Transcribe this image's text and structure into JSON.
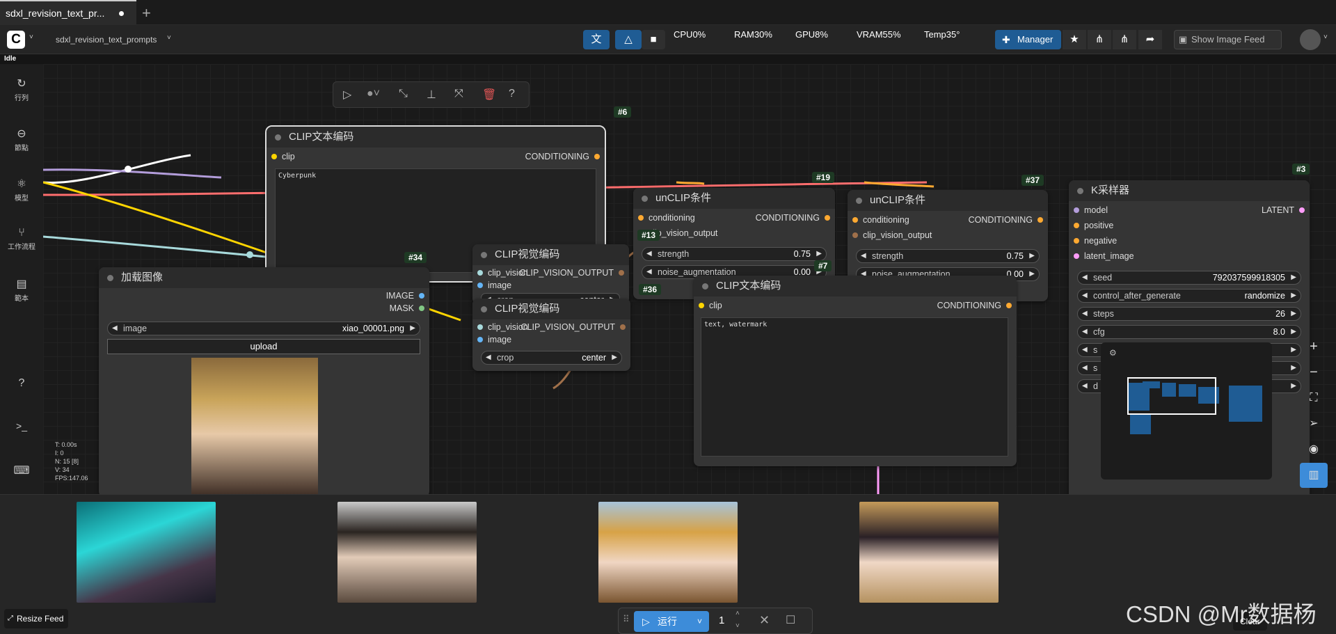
{
  "tab": {
    "title": "sdxl_revision_text_pr...",
    "new_tab": "+"
  },
  "topbar": {
    "workflow_name": "sdxl_revision_text_prompts",
    "workflow_caret": "˅",
    "stats": {
      "cpu": "CPU0%",
      "ram": "RAM30%",
      "gpu": "GPU8%",
      "vram": "VRAM55%",
      "temp": "Temp35°"
    },
    "manager_label": "Manager",
    "show_feed_label": "Show Image Feed"
  },
  "status": "Idle",
  "sidebar": {
    "items": [
      {
        "icon": "history-icon",
        "glyph": "↻",
        "label": "行列"
      },
      {
        "icon": "node-library-icon",
        "glyph": "⊖",
        "label": "節點"
      },
      {
        "icon": "model-icon",
        "glyph": "⚛",
        "label": "模型"
      },
      {
        "icon": "workflow-icon",
        "glyph": "⑂",
        "label": "工作流程"
      },
      {
        "icon": "template-icon",
        "glyph": "▤",
        "label": "範本"
      }
    ],
    "help_glyph": "?",
    "terminal_glyph": ">_",
    "keyboard_glyph": "⌨"
  },
  "nodes": {
    "n6": {
      "id": "#6",
      "title": "CLIP文本编码",
      "in_clip": "clip",
      "out": "CONDITIONING",
      "text": "Cyberpunk"
    },
    "n19": {
      "id": "#19",
      "title": "unCLIP条件",
      "in1": "conditioning",
      "in2": "clip_vision_output",
      "out": "CONDITIONING",
      "strength_label": "strength",
      "strength": "0.75",
      "noise_label": "noise_augmentation",
      "noise": "0.00"
    },
    "n37": {
      "id": "#37",
      "title": "unCLIP条件",
      "in1": "conditioning",
      "in2": "clip_vision_output",
      "out": "CONDITIONING",
      "strength_label": "strength",
      "strength": "0.75",
      "noise_label": "noise_augmentation",
      "noise": "0.00"
    },
    "n3": {
      "id": "#3",
      "title": "K采样器",
      "in_model": "model",
      "in_positive": "positive",
      "in_negative": "negative",
      "in_latent": "latent_image",
      "out": "LATENT",
      "seed_label": "seed",
      "seed": "792037599918305",
      "cag_label": "control_after_generate",
      "cag": "randomize",
      "steps_label": "steps",
      "steps": "26",
      "cfg_label": "cfg",
      "cfg": "8.0",
      "s1": "s",
      "s2": "s",
      "d": "d"
    },
    "n13": {
      "id": "#13",
      "title": "CLIP视觉编码",
      "in1": "clip_vision",
      "in2": "image",
      "out": "CLIP_VISION_OUTPUT",
      "crop_label": "crop",
      "crop": "center"
    },
    "n36": {
      "id": "#36",
      "title": "CLIP视觉编码",
      "in1": "clip_vision",
      "in2": "image",
      "out": "CLIP_VISION_OUTPUT",
      "crop_label": "crop",
      "crop": "center"
    },
    "n34": {
      "id": "#34",
      "title": "加载图像",
      "out_image": "IMAGE",
      "out_mask": "MASK",
      "image_label": "image",
      "image": "xiao_00001.png",
      "upload": "upload"
    },
    "n7": {
      "id": "#7",
      "title": "CLIP文本编码",
      "in_clip": "clip",
      "out": "CONDITIONING",
      "text": "text, watermark"
    }
  },
  "canvas_stats": {
    "t": "T: 0.00s",
    "i": "I: 0",
    "n": "N: 15 [8]",
    "v": "V: 34",
    "fps": "FPS:147.06"
  },
  "feed": {
    "resize_label": "Resize Feed",
    "clear_label": "Clear"
  },
  "run": {
    "label": "运行",
    "count": "1"
  },
  "watermark": "CSDN @Mr数据杨",
  "colors": {
    "accent": "#1f5c94",
    "run": "#3d8cd9",
    "clip": "#ffd500",
    "conditioning": "#ffa931",
    "clip_vision": "#a8dadc",
    "image": "#64b5f6",
    "latent": "#ff9cf9",
    "model": "#b39ddb",
    "vae": "#ff6e6e"
  }
}
